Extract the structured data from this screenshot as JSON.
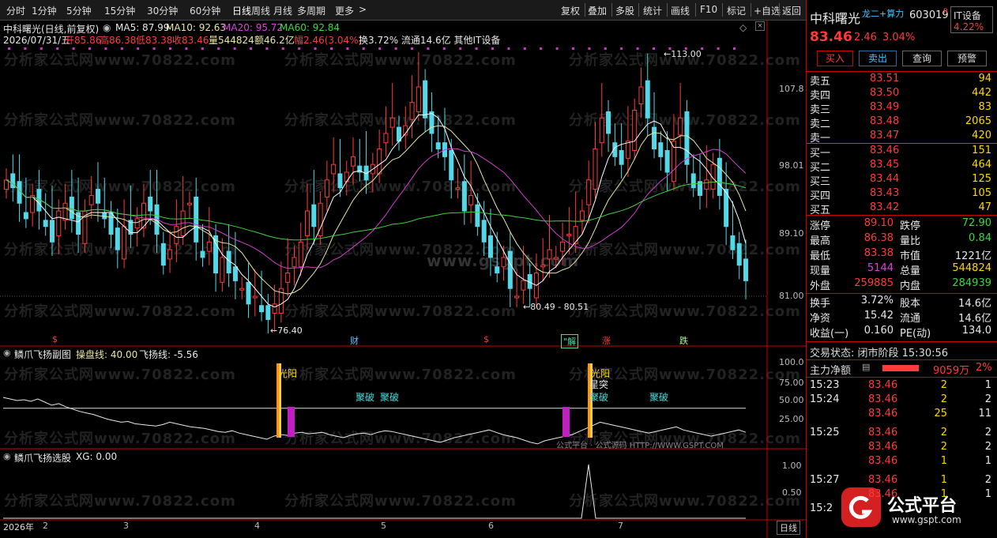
{
  "toolbar": {
    "left": [
      "分时",
      "1分钟",
      "5分钟",
      "15分钟",
      "30分钟",
      "60分钟",
      "日线",
      "周线",
      "月线",
      "多周期",
      "更多"
    ],
    "right": [
      "复权",
      "叠加",
      "多股",
      "统计",
      "画线",
      "F10",
      "标记",
      "+自选",
      "返回"
    ]
  },
  "main": {
    "title": "中科曙光(日线,前复权)",
    "ma5": "MA5: 87.99",
    "ma10": "MA10: 92.63",
    "ma20": "MA20: 95.72",
    "ma60": "MA60: 92.84",
    "info_date": "2026/07/31/五",
    "info_open": "开85.86",
    "info_high": "高86.38",
    "info_low": "低83.38",
    "info_close": "收83.46",
    "info_vol": "量544824",
    "info_amt": "额46.2亿",
    "info_range": "幅2.46(3.04%)",
    "info_rest": "换3.72% 流通14.6亿 其他IT设备",
    "y_ticks": [
      "107.8",
      "98.01",
      "89.10",
      "81.00"
    ],
    "hi_label": "113.00",
    "lo_label": "76.40",
    "mid_label": "80.49 - 80.51",
    "markers": [
      "$",
      "财",
      "$",
      "解",
      "涨",
      "跌"
    ],
    "watermark": "分析家公式网www.70822.com",
    "center_mark": "www.gsgpt.com"
  },
  "sub1": {
    "title": "鳞爪飞扬副图",
    "pan": "操盘线: 40.00",
    "fly": "飞扬线: -5.56",
    "y_ticks": [
      "100.0",
      "75.00",
      "50.00",
      "25.00"
    ],
    "labels": [
      "光阳",
      "聚破",
      "聚破",
      "光阳",
      "星突",
      "聚破",
      "聚破"
    ],
    "footer": "公式平台 · 公式源码 HTTP://WWW.GSPT.COM"
  },
  "sub2": {
    "title": "鳞爪飞扬选股",
    "xg": "XG: 0.00",
    "y_ticks": [
      "1.00",
      "0.50"
    ]
  },
  "xaxis": {
    "labels": [
      "2026年",
      "2",
      "3",
      "4",
      "5",
      "6",
      "7"
    ],
    "period": "日线"
  },
  "quote": {
    "name": "中科曙光",
    "tag": "龙二+算力",
    "code": "603019",
    "r": "R",
    "sector": "IT设备",
    "sector_pct": "4.22%",
    "price": "83.46",
    "chg": "2.46",
    "pct": "3.04%",
    "buttons": [
      "买入",
      "卖出",
      "查询",
      "预警"
    ],
    "asks": [
      {
        "label": "卖五",
        "price": "83.51",
        "vol": "94"
      },
      {
        "label": "卖四",
        "price": "83.50",
        "vol": "442"
      },
      {
        "label": "卖三",
        "price": "83.49",
        "vol": "83"
      },
      {
        "label": "卖二",
        "price": "83.48",
        "vol": "2065"
      },
      {
        "label": "卖一",
        "price": "83.47",
        "vol": "420"
      }
    ],
    "bids": [
      {
        "label": "买一",
        "price": "83.46",
        "vol": "151"
      },
      {
        "label": "买二",
        "price": "83.45",
        "vol": "464"
      },
      {
        "label": "买三",
        "price": "83.44",
        "vol": "125"
      },
      {
        "label": "买四",
        "price": "83.43",
        "vol": "105"
      },
      {
        "label": "买五",
        "price": "83.42",
        "vol": "47"
      }
    ],
    "stats": [
      {
        "k1": "涨停",
        "v1": "89.10",
        "k2": "跌停",
        "v2": "72.90"
      },
      {
        "k1": "最高",
        "v1": "86.38",
        "k2": "量比",
        "v2": "0.84"
      },
      {
        "k1": "最低",
        "v1": "83.38",
        "k2": "市值",
        "v2": "1221亿"
      },
      {
        "k1": "现量",
        "v1": "5144",
        "k2": "总量",
        "v2": "544824"
      },
      {
        "k1": "外盘",
        "v1": "259885",
        "k2": "内盘",
        "v2": "284939"
      }
    ],
    "stats2": [
      {
        "k1": "换手",
        "v1": "3.72%",
        "k2": "股本",
        "v2": "14.6亿"
      },
      {
        "k1": "净资",
        "v1": "15.42",
        "k2": "流通",
        "v2": "14.6亿"
      },
      {
        "k1": "收益(一)",
        "v1": "0.160",
        "k2": "PE(动)",
        "v2": "134.0"
      }
    ],
    "status": "交易状态: 闭市阶段 15:30:56",
    "net_label": "主力净额",
    "net_val": "9059万",
    "net_pct": "2%",
    "ticks": [
      {
        "t": "15:23",
        "p": "83.46",
        "v": "2",
        "n": "1"
      },
      {
        "t": "15:24",
        "p": "83.46",
        "v": "2",
        "n": "2"
      },
      {
        "t": "",
        "p": "83.46",
        "v": "25",
        "n": "11"
      },
      {
        "t": "15:25",
        "p": "83.46",
        "v": "2",
        "n": "2"
      },
      {
        "t": "",
        "p": "83.46",
        "v": "2",
        "n": "2"
      },
      {
        "t": "",
        "p": "83.46",
        "v": "1",
        "n": "1"
      },
      {
        "t": "15:27",
        "p": "83.46",
        "v": "1",
        "n": "2"
      },
      {
        "t": "",
        "p": "83.46",
        "v": "1",
        "n": "1"
      },
      {
        "t": "15:2",
        "p": "",
        "v": "",
        "n": ""
      }
    ],
    "logo_text": "公式平台",
    "logo_url": "www.gspt.com"
  },
  "colors": {
    "up": "#ff3b3b",
    "down": "#54d8e8",
    "ma5": "#ffffff",
    "ma10": "#e8e8a0",
    "ma20": "#d040d0",
    "ma60": "#40d040"
  }
}
